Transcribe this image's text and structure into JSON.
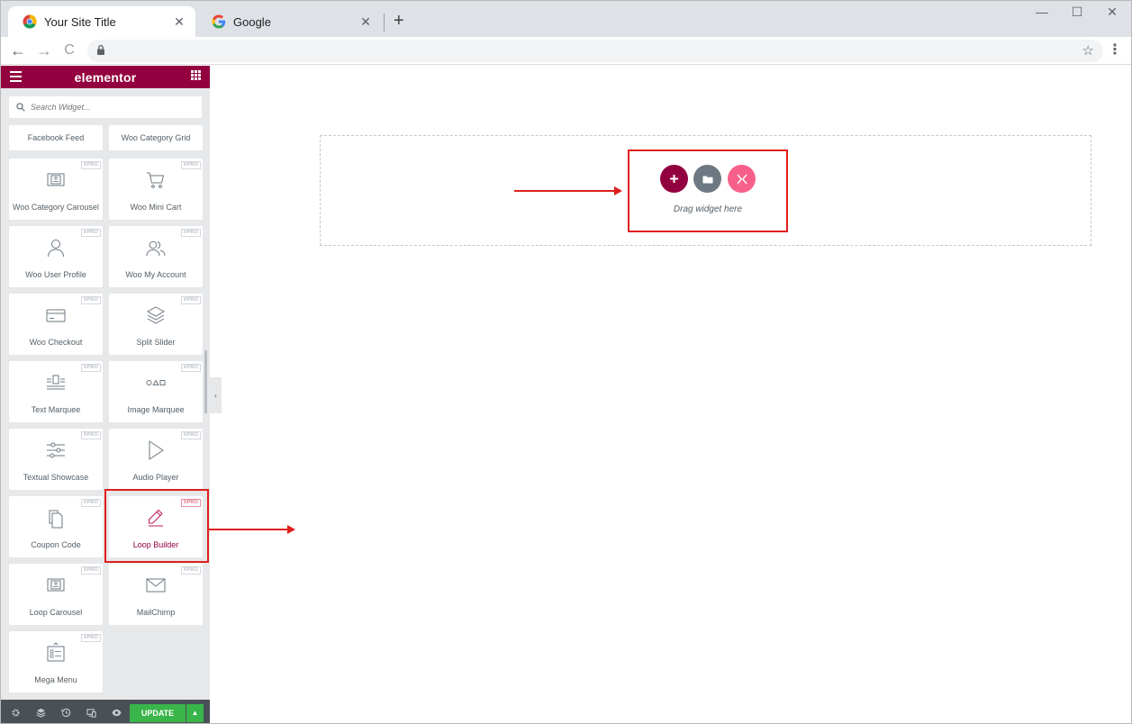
{
  "browser": {
    "tabs": [
      {
        "title": "Your Site Title",
        "active": true
      },
      {
        "title": "Google",
        "active": false
      }
    ],
    "new_tab": "+",
    "window_controls": {
      "minimize": "—",
      "maximize": "☐",
      "close": "✕"
    },
    "nav": {
      "back": "←",
      "forward": "→",
      "reload": "C"
    },
    "tab_close": "✕"
  },
  "panel": {
    "logo": "elementor",
    "search_placeholder": "Search Widget...",
    "collapse": "‹",
    "widgets": [
      {
        "label": "Facebook Feed",
        "icon": null,
        "badge": null,
        "highlighted": false
      },
      {
        "label": "Woo Category Grid",
        "icon": null,
        "badge": null,
        "highlighted": false
      },
      {
        "label": "Woo Category Carousel",
        "icon": "carousel-icon",
        "badge": "XPRO",
        "highlighted": false
      },
      {
        "label": "Woo Mini Cart",
        "icon": "cart-icon",
        "badge": "XPRO",
        "highlighted": false
      },
      {
        "label": "Woo User Profile",
        "icon": "user-icon",
        "badge": "XPRO",
        "highlighted": false
      },
      {
        "label": "Woo My Account",
        "icon": "users-icon",
        "badge": "XPRO",
        "highlighted": false
      },
      {
        "label": "Woo Checkout",
        "icon": "card-icon",
        "badge": "XPRO",
        "highlighted": false
      },
      {
        "label": "Split Slider",
        "icon": "layers-icon",
        "badge": "XPRO",
        "highlighted": false
      },
      {
        "label": "Text Marquee",
        "icon": "text-marquee-icon",
        "badge": "XPRO",
        "highlighted": false
      },
      {
        "label": "Image Marquee",
        "icon": "image-marquee-icon",
        "badge": "XPRO",
        "highlighted": false
      },
      {
        "label": "Textual Showcase",
        "icon": "sliders-icon",
        "badge": "XPRO",
        "highlighted": false
      },
      {
        "label": "Audio Player",
        "icon": "play-icon",
        "badge": "XPRO",
        "highlighted": false
      },
      {
        "label": "Coupon Code",
        "icon": "copy-icon",
        "badge": "XPRO",
        "highlighted": false
      },
      {
        "label": "Loop Builder",
        "icon": "pencil-icon",
        "badge": "XPRO",
        "highlighted": true
      },
      {
        "label": "Loop Carousel",
        "icon": "carousel-icon",
        "badge": "XPRO",
        "highlighted": false
      },
      {
        "label": "MailChimp",
        "icon": "mail-icon",
        "badge": "XPRO",
        "highlighted": false
      },
      {
        "label": "Mega Menu",
        "icon": "mega-menu-icon",
        "badge": "XPRO",
        "highlighted": false
      }
    ],
    "footer": {
      "icons": [
        "settings-icon",
        "layers-icon",
        "history-icon",
        "responsive-icon",
        "preview-icon"
      ],
      "update_label": "UPDATE",
      "update_arrow": "▲"
    }
  },
  "canvas": {
    "drag_text": "Drag widget here",
    "buttons": [
      "add-icon",
      "folder-icon",
      "close-icon"
    ]
  },
  "colors": {
    "brand": "#93003f",
    "update": "#39b54a",
    "annotation": "#e01e1e",
    "template_button": "#6d7882",
    "close_button": "#f7608a"
  }
}
